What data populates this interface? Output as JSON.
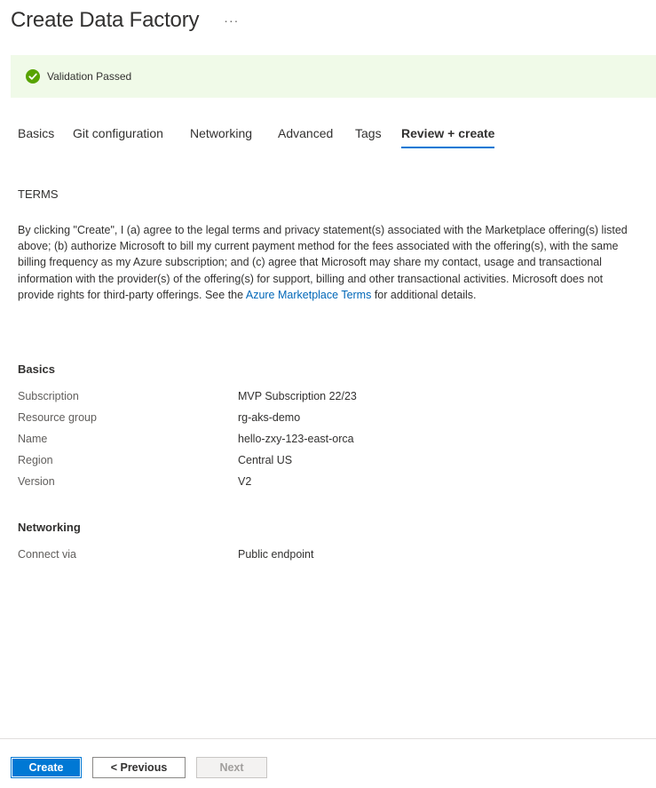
{
  "header": {
    "title": "Create Data Factory",
    "more_label": "···"
  },
  "validation": {
    "message": "Validation Passed",
    "status_color": "#57a300"
  },
  "tabs": [
    {
      "label": "Basics"
    },
    {
      "label": "Git configuration"
    },
    {
      "label": "Networking"
    },
    {
      "label": "Advanced"
    },
    {
      "label": "Tags"
    },
    {
      "label": "Review + create",
      "active": true
    }
  ],
  "terms": {
    "heading": "TERMS",
    "text_before": "By clicking \"Create\", I (a) agree to the legal terms and privacy statement(s) associated with the Marketplace offering(s) listed above; (b) authorize Microsoft to bill my current payment method for the fees associated with the offering(s), with the same billing frequency as my Azure subscription; and (c) agree that Microsoft may share my contact, usage and transactional information with the provider(s) of the offering(s) for support, billing and other transactional activities. Microsoft does not provide rights for third-party offerings. See the ",
    "link_text": "Azure Marketplace Terms",
    "text_after": " for additional details."
  },
  "basics": {
    "heading": "Basics",
    "rows": [
      {
        "label": "Subscription",
        "value": "MVP Subscription 22/23"
      },
      {
        "label": "Resource group",
        "value": "rg-aks-demo"
      },
      {
        "label": "Name",
        "value": "hello-zxy-123-east-orca"
      },
      {
        "label": "Region",
        "value": "Central US"
      },
      {
        "label": "Version",
        "value": "V2"
      }
    ]
  },
  "networking": {
    "heading": "Networking",
    "rows": [
      {
        "label": "Connect via",
        "value": "Public endpoint"
      }
    ]
  },
  "footer": {
    "create_label": "Create",
    "previous_label": "< Previous",
    "next_label": "Next"
  }
}
